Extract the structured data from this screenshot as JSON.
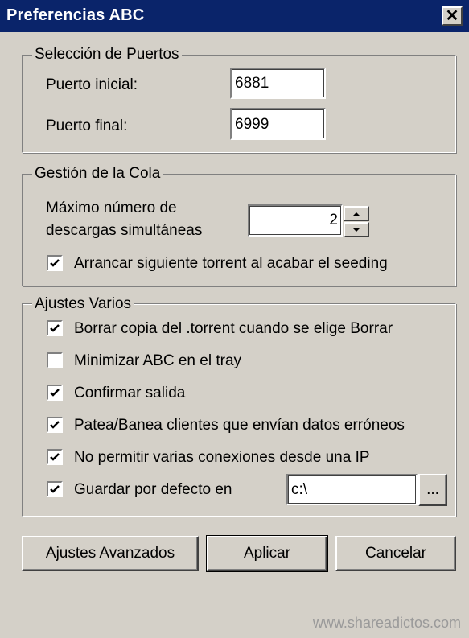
{
  "window": {
    "title": "Preferencias ABC",
    "close_label": "✕"
  },
  "ports": {
    "legend": "Selección de Puertos",
    "start_label": "Puerto inicial:",
    "start_value": "6881",
    "end_label": "Puerto final:",
    "end_value": "6999"
  },
  "queue": {
    "legend": "Gestión de la Cola",
    "max_label_line1": "Máximo número de",
    "max_label_line2": "descargas simultáneas",
    "max_value": "2",
    "start_next_label": "Arrancar siguiente torrent al acabar el seeding",
    "start_next_checked": true
  },
  "misc": {
    "legend": "Ajustes Varios",
    "options": [
      {
        "label": "Borrar copia del .torrent cuando se elige Borrar",
        "checked": true
      },
      {
        "label": "Minimizar ABC en el tray",
        "checked": false
      },
      {
        "label": "Confirmar salida",
        "checked": true
      },
      {
        "label": "Patea/Banea clientes que envían datos erróneos",
        "checked": true
      },
      {
        "label": "No permitir varias conexiones desde una IP",
        "checked": true
      },
      {
        "label": "Guardar por defecto en",
        "checked": true
      }
    ],
    "save_path_value": "c:\\",
    "browse_label": "..."
  },
  "buttons": {
    "advanced": "Ajustes Avanzados",
    "apply": "Aplicar",
    "cancel": "Cancelar"
  },
  "watermark": "www.shareadictos.com"
}
